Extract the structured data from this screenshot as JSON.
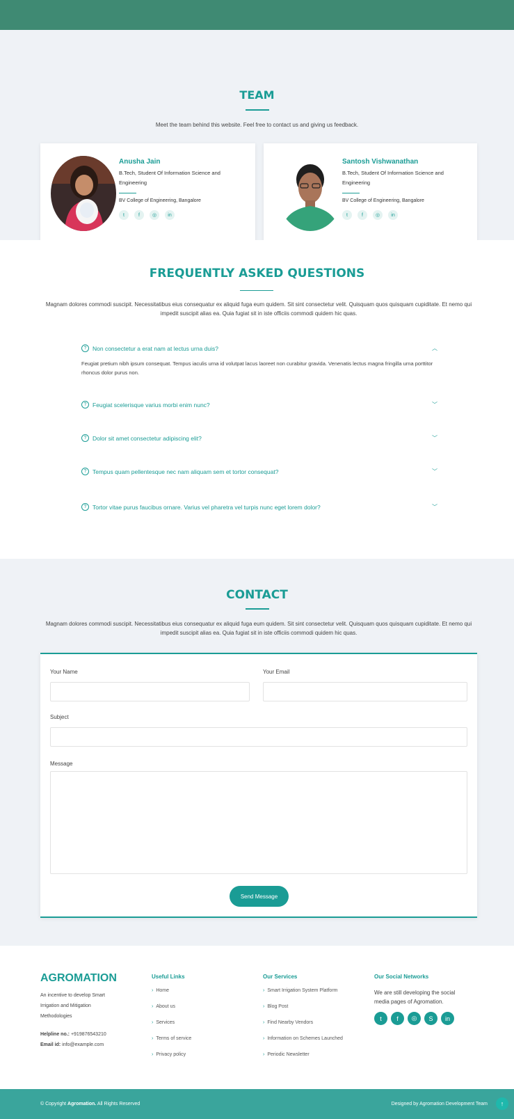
{
  "team": {
    "title": "TEAM",
    "description": "Meet the team behind this website. Feel free to contact us and giving us feedback.",
    "members": [
      {
        "name": "Anusha Jain",
        "role": "B.Tech, Student Of Information Science and Engineering",
        "college": "BV College of Engineering, Bangalore"
      },
      {
        "name": "Santosh Vishwanathan",
        "role": "B.Tech, Student Of Information Science and Engineering",
        "college": "BV College of Engineering, Bangalore"
      }
    ]
  },
  "faq": {
    "title": "FREQUENTLY ASKED QUESTIONS",
    "description": "Magnam dolores commodi suscipit. Necessitatibus eius consequatur ex aliquid fuga eum quidem. Sit sint consectetur velit. Quisquam quos quisquam cupiditate. Et nemo qui impedit suscipit alias ea. Quia fugiat sit in iste officiis commodi quidem hic quas.",
    "items": [
      {
        "question": "Non consectetur a erat nam at lectus urna duis?",
        "answer": "Feugiat pretium nibh ipsum consequat. Tempus iaculis urna id volutpat lacus laoreet non curabitur gravida. Venenatis lectus magna fringilla urna porttitor rhoncus dolor purus non.",
        "expanded": true
      },
      {
        "question": "Feugiat scelerisque varius morbi enim nunc?",
        "expanded": false
      },
      {
        "question": "Dolor sit amet consectetur adipiscing elit?",
        "expanded": false
      },
      {
        "question": "Tempus quam pellentesque nec nam aliquam sem et tortor consequat?",
        "expanded": false
      },
      {
        "question": "Tortor vitae purus faucibus ornare. Varius vel pharetra vel turpis nunc eget lorem dolor?",
        "expanded": false
      }
    ]
  },
  "contact": {
    "title": "CONTACT",
    "description": "Magnam dolores commodi suscipit. Necessitatibus eius consequatur ex aliquid fuga eum quidem. Sit sint consectetur velit. Quisquam quos quisquam cupiditate. Et nemo qui impedit suscipit alias ea. Quia fugiat sit in iste officiis commodi quidem hic quas.",
    "name_label": "Your Name",
    "email_label": "Your Email",
    "subject_label": "Subject",
    "message_label": "Message",
    "send_label": "Send Message"
  },
  "footer": {
    "brand": "AGROMATION",
    "tagline": "An incentive to develop Smart Irrigation and Mitigation Methodologies",
    "helpline_label": "Helpline no.:",
    "helpline_value": "+919876543210",
    "email_label": "Email id:",
    "email_value": "info@example.com",
    "useful_links": {
      "title": "Useful Links",
      "items": [
        "Home",
        "About us",
        "Services",
        "Terms of service",
        "Privacy policy"
      ]
    },
    "services": {
      "title": "Our Services",
      "items": [
        "Smart Irrigation System Platform",
        "Blog Post",
        "Find Nearby Vendors",
        "Information on Schemes Launched",
        "Periodic Newsletter"
      ]
    },
    "social": {
      "title": "Our Social Networks",
      "text": "We are still developing the social media pages of Agromation."
    },
    "copyright_prefix": "© Copyright",
    "copyright_brand": "Agromation.",
    "copyright_suffix": "All Rights Reserved",
    "credit": "Designed by Agromation Development Team"
  }
}
